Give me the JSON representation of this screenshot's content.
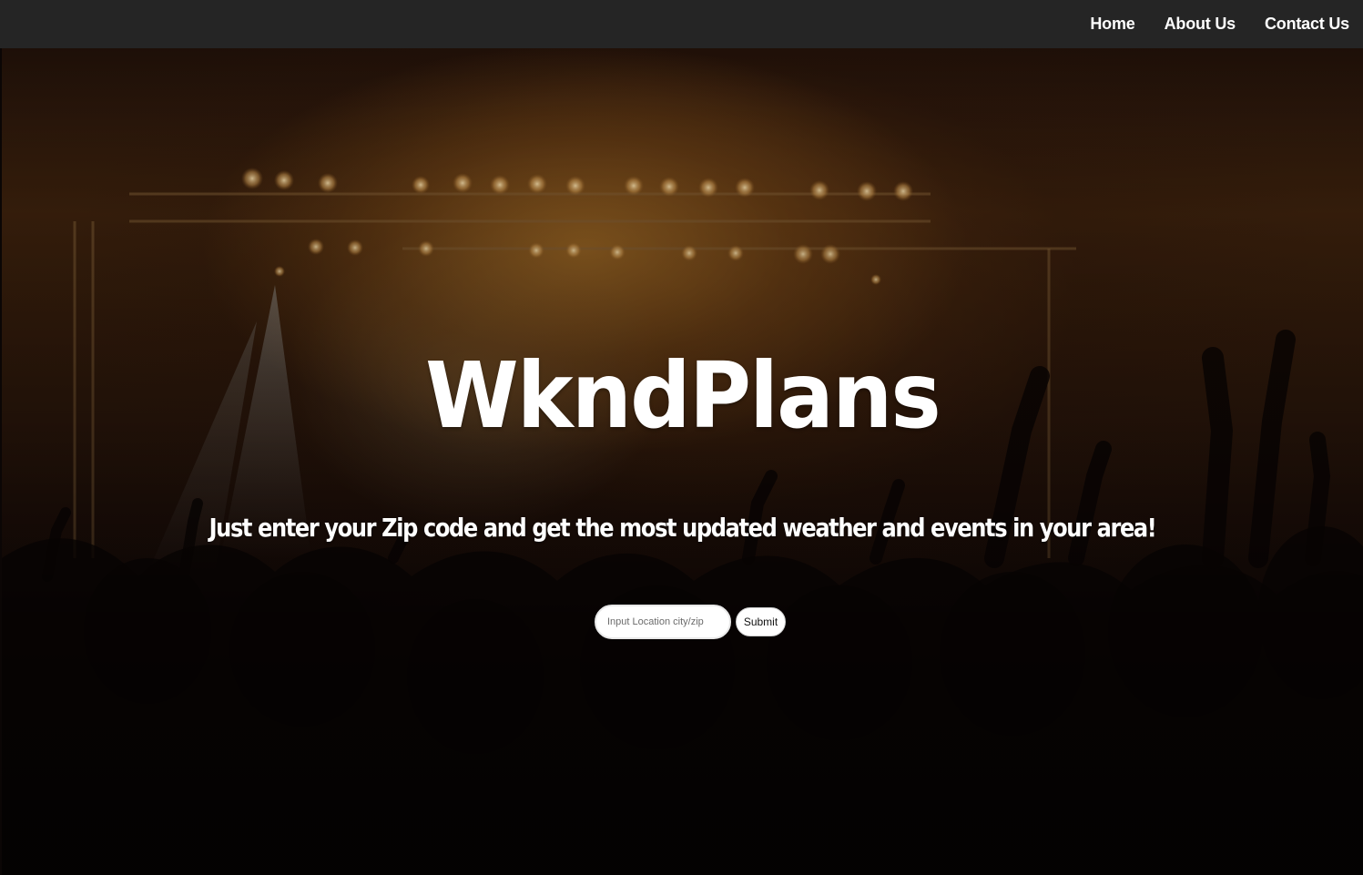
{
  "nav": {
    "items": [
      {
        "label": "Home"
      },
      {
        "label": "About Us"
      },
      {
        "label": "Contact Us"
      }
    ]
  },
  "hero": {
    "title": "WkndPlans",
    "tagline": "Just enter your Zip code and get the most updated weather and events in your area!",
    "background_image": "concert-crowd-stage-lights"
  },
  "search": {
    "placeholder": "Input Location city/zip",
    "value": "",
    "submit_label": "Submit"
  },
  "colors": {
    "navbar": "#252525",
    "text": "#ffffff",
    "accent_glow": "#9a6423"
  }
}
